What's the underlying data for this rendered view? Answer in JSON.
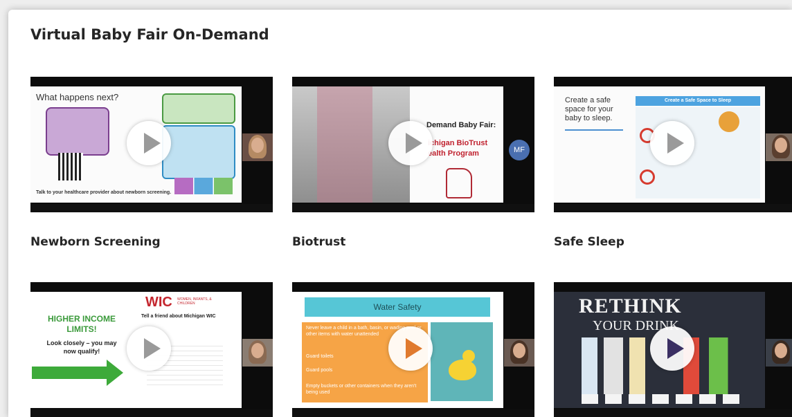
{
  "page": {
    "title": "Virtual Baby Fair On-Demand"
  },
  "videos": [
    {
      "title": "Newborn Screening",
      "slide_heading": "What happens next?",
      "slide_footer": "Talk to your healthcare provider about newborn screening."
    },
    {
      "title": "Biotrust",
      "slide_line1": "Demand Baby Fair:",
      "slide_line2": "ichigan BioTrust",
      "slide_line3": "ealth Program",
      "avatar_initials": "MF",
      "logo_text": "Michigan BioTrust for Health"
    },
    {
      "title": "Safe Sleep",
      "slide_heading": "Create a safe space for your baby to sleep.",
      "slide_banner": "Create a Safe Space to Sleep"
    },
    {
      "title": "",
      "slide_line1": "HIGHER INCOME LIMITS!",
      "slide_line2": "Look closely – you may now qualify!",
      "logo_text": "WIC",
      "logo_sub": "WOMEN, INFANTS, & CHILDREN",
      "slide_blurb": "Tell a friend about Michigan WIC"
    },
    {
      "title": "",
      "slide_heading": "Water Safety",
      "bullets": [
        "Never leave a child in a bath, basin, or wading pool or other items with water unattended",
        "Guard toilets",
        "Guard pools",
        "Empty buckets or other containers when they aren't being used"
      ]
    },
    {
      "title": "",
      "slide_line1": "RETHINK",
      "slide_line2": "YOUR DRINK"
    }
  ],
  "colors": {
    "title": "#262626",
    "orange_play": "#e07a2e",
    "purple_play": "#3a2f63"
  }
}
